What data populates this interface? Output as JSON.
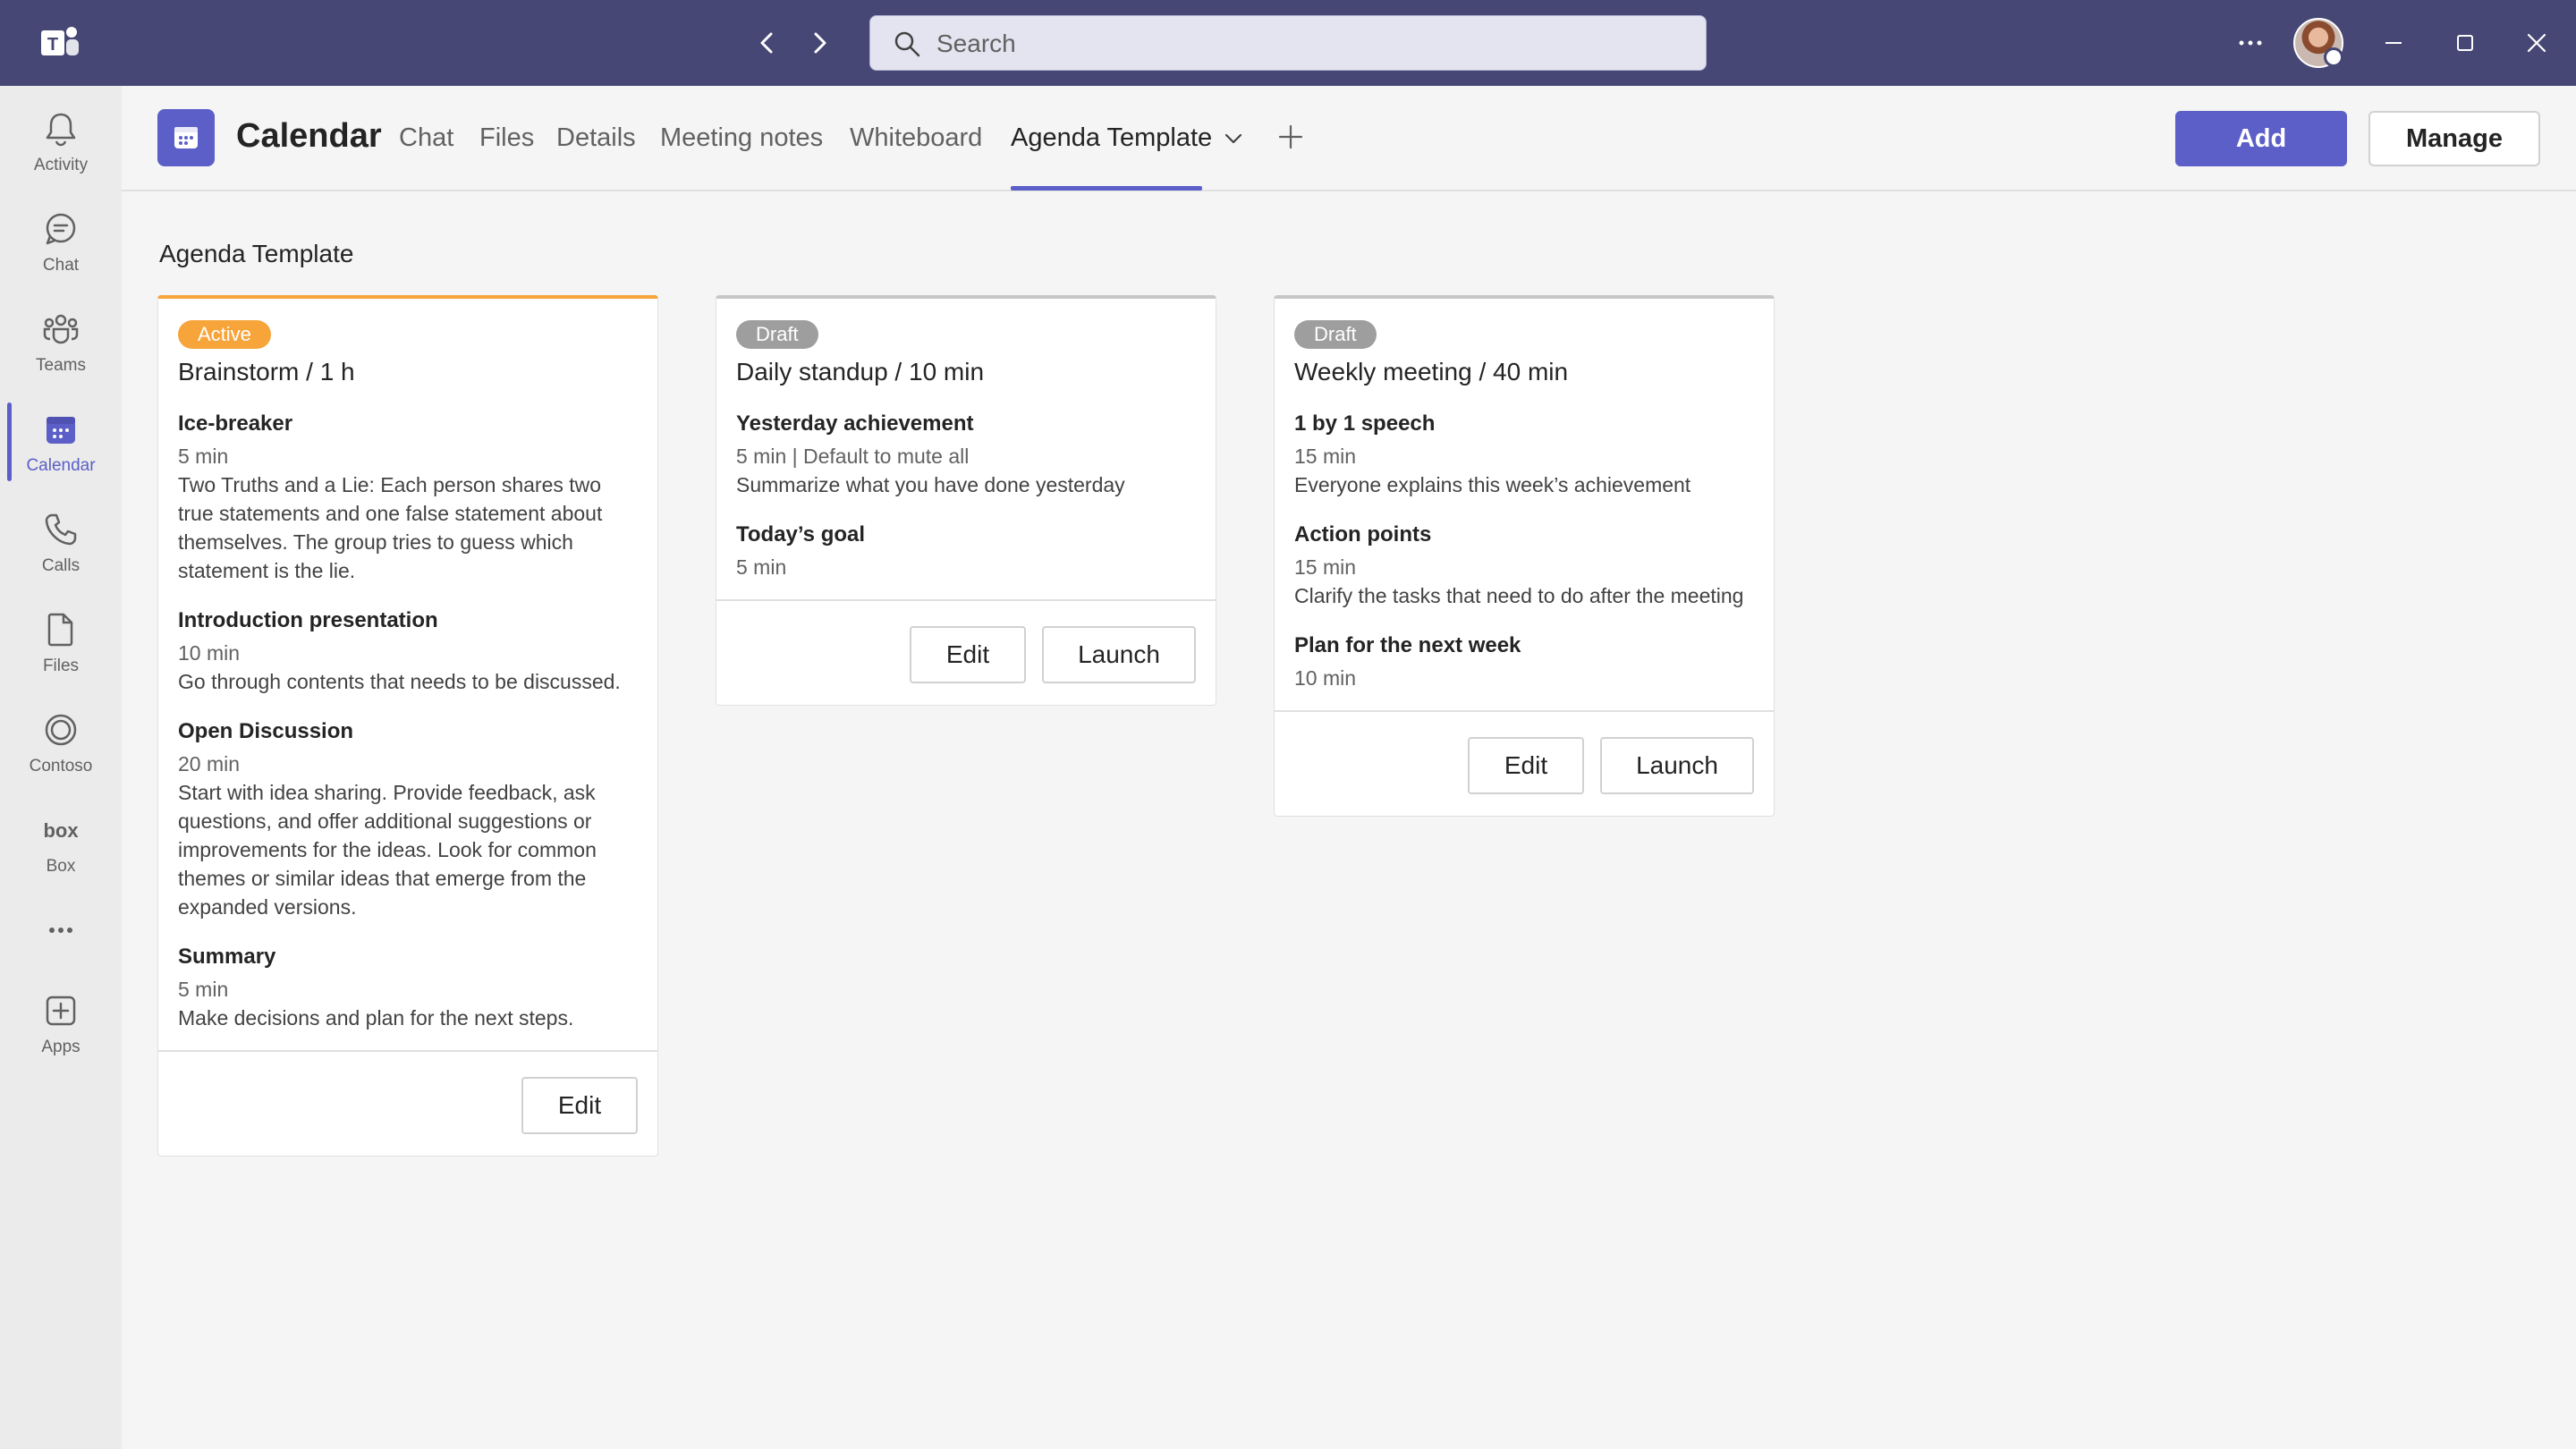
{
  "titlebar": {
    "search_placeholder": "Search",
    "icons": [
      "teams-logo-icon",
      "back-arrow-icon",
      "forward-arrow-icon",
      "search-icon",
      "more-icon",
      "minimize-icon",
      "maximize-icon",
      "close-icon"
    ]
  },
  "rail": {
    "items": [
      {
        "label": "Activity",
        "icon": "bell-icon"
      },
      {
        "label": "Chat",
        "icon": "chat-icon"
      },
      {
        "label": "Teams",
        "icon": "teams-icon"
      },
      {
        "label": "Calendar",
        "icon": "calendar-icon",
        "active": true
      },
      {
        "label": "Calls",
        "icon": "phone-icon"
      },
      {
        "label": "Files",
        "icon": "file-icon"
      },
      {
        "label": "Contoso",
        "icon": "contoso-icon"
      },
      {
        "label": "Box",
        "icon": "box-icon"
      },
      {
        "label": "",
        "icon": "more-apps-icon"
      },
      {
        "label": "Apps",
        "icon": "add-apps-icon"
      }
    ]
  },
  "header": {
    "title": "Calendar",
    "tabs": [
      {
        "label": "Chat"
      },
      {
        "label": "Files"
      },
      {
        "label": "Details"
      },
      {
        "label": "Meeting notes"
      },
      {
        "label": "Whiteboard"
      },
      {
        "label": "Agenda Template",
        "active": true
      }
    ],
    "add_label": "Add",
    "manage_label": "Manage"
  },
  "section_title": "Agenda Template",
  "cards": [
    {
      "status": "Active",
      "title": "Brainstorm / 1 h",
      "items": [
        {
          "name": "Ice-breaker",
          "meta": "5 min",
          "desc": "Two Truths and a Lie: Each person shares two true statements and one false statement about themselves. The group tries to guess which statement is the lie."
        },
        {
          "name": "Introduction presentation",
          "meta": "10 min",
          "desc": "Go through contents that needs to be discussed."
        },
        {
          "name": "Open Discussion",
          "meta": "20 min",
          "desc": "Start with idea sharing. Provide feedback, ask questions, and offer additional suggestions or improvements for the ideas. Look for common themes or similar ideas that emerge from the expanded versions."
        },
        {
          "name": "Summary",
          "meta": "5 min",
          "desc": "Make decisions and plan for the next steps."
        }
      ],
      "buttons": [
        "Edit"
      ]
    },
    {
      "status": "Draft",
      "title": "Daily standup / 10 min",
      "items": [
        {
          "name": "Yesterday achievement",
          "meta": "5 min | Default to mute all",
          "desc": "Summarize what you have done yesterday"
        },
        {
          "name": "Today’s goal",
          "meta": "5 min",
          "desc": ""
        }
      ],
      "buttons": [
        "Edit",
        "Launch"
      ]
    },
    {
      "status": "Draft",
      "title": "Weekly meeting / 40 min",
      "items": [
        {
          "name": "1 by 1 speech",
          "meta": "15 min",
          "desc": "Everyone explains this week’s achievement"
        },
        {
          "name": "Action points",
          "meta": "15 min",
          "desc": "Clarify the tasks that need to do after the meeting"
        },
        {
          "name": "Plan for the next week",
          "meta": "10 min",
          "desc": ""
        }
      ],
      "buttons": [
        "Edit",
        "Launch"
      ]
    }
  ],
  "colors": {
    "titlebar": "#464775",
    "accent": "#5b5fc7",
    "active_badge": "#f7a43b",
    "draft_badge": "#9e9e9e"
  }
}
